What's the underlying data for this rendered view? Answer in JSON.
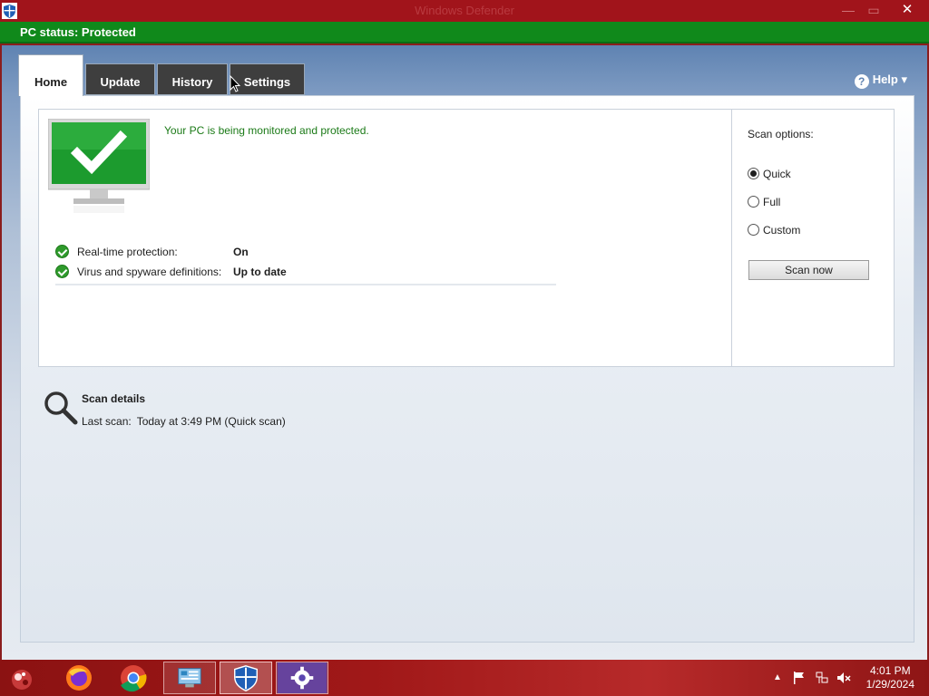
{
  "window": {
    "title": "Windows Defender",
    "minimize": "—",
    "maximize": "▭",
    "close": "✕"
  },
  "status": {
    "text": "PC status: Protected",
    "color": "#10891b"
  },
  "tabs": [
    {
      "label": "Home",
      "active": true
    },
    {
      "label": "Update",
      "active": false
    },
    {
      "label": "History",
      "active": false
    },
    {
      "label": "Settings",
      "active": false
    }
  ],
  "help": {
    "label": "Help ▾",
    "icon": "question-icon"
  },
  "home": {
    "message": "Your PC is being monitored and protected.",
    "rows": [
      {
        "label": "Real-time protection:",
        "value": "On"
      },
      {
        "label": "Virus and spyware definitions:",
        "value": "Up to date"
      }
    ]
  },
  "scan": {
    "title": "Scan options:",
    "options": [
      {
        "label": "Quick",
        "checked": true
      },
      {
        "label": "Full",
        "checked": false
      },
      {
        "label": "Custom",
        "checked": false
      }
    ],
    "button": "Scan now"
  },
  "scan_details": {
    "title": "Scan details",
    "last_label": "Last scan:",
    "last_value": "Today at 3:49 PM (Quick scan)"
  },
  "taskbar": {
    "apps": [
      "start-icon",
      "firefox-icon",
      "chrome-icon",
      "control-panel-icon",
      "defender-icon",
      "settings-icon"
    ],
    "clock_time": "4:01 PM",
    "clock_date": "1/29/2024",
    "accent": "#a1141b"
  }
}
